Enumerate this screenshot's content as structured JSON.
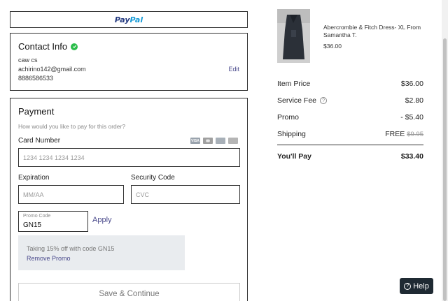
{
  "paypal": {
    "logo_pay": "Pay",
    "logo_pal": "Pal"
  },
  "contact": {
    "title": "Contact Info",
    "name": "caw cs",
    "email": "achirino142@gmail.com",
    "phone": "8886586533",
    "edit_label": "Edit"
  },
  "payment": {
    "title": "Payment",
    "subtitle": "How would you like to pay for this order?",
    "card_number_label": "Card Number",
    "card_number_placeholder": "1234 1234 1234 1234",
    "card_brands": [
      "visa-icon",
      "mastercard-icon",
      "amex-icon",
      "generic-card-icon"
    ],
    "card_brand_visa": "VISA",
    "expiration_label": "Expiration",
    "expiration_placeholder": "MM/AA",
    "security_label": "Security Code",
    "security_placeholder": "CVC",
    "promo_label": "Promo Code",
    "promo_value": "GN15",
    "apply_label": "Apply",
    "promo_applied_text": "Taking 15% off with code GN15",
    "remove_promo_label": "Remove Promo",
    "save_label": "Save & Continue"
  },
  "product": {
    "title": "Abercrombie & Fitch Dress- XL From Samantha T.",
    "price": "$36.00"
  },
  "summary": {
    "item_price_label": "Item Price",
    "item_price": "$36.00",
    "service_fee_label": "Service Fee",
    "service_fee": "$2.80",
    "promo_label": "Promo",
    "promo": "- $5.40",
    "shipping_label": "Shipping",
    "shipping": "FREE",
    "shipping_original": "$9.95",
    "total_label": "You'll Pay",
    "total": "$33.40"
  },
  "help": {
    "label": "Help"
  },
  "colors": {
    "accent_link": "#4a4a8c",
    "success": "#2bbd4a",
    "help_bg": "#1f2a33"
  }
}
